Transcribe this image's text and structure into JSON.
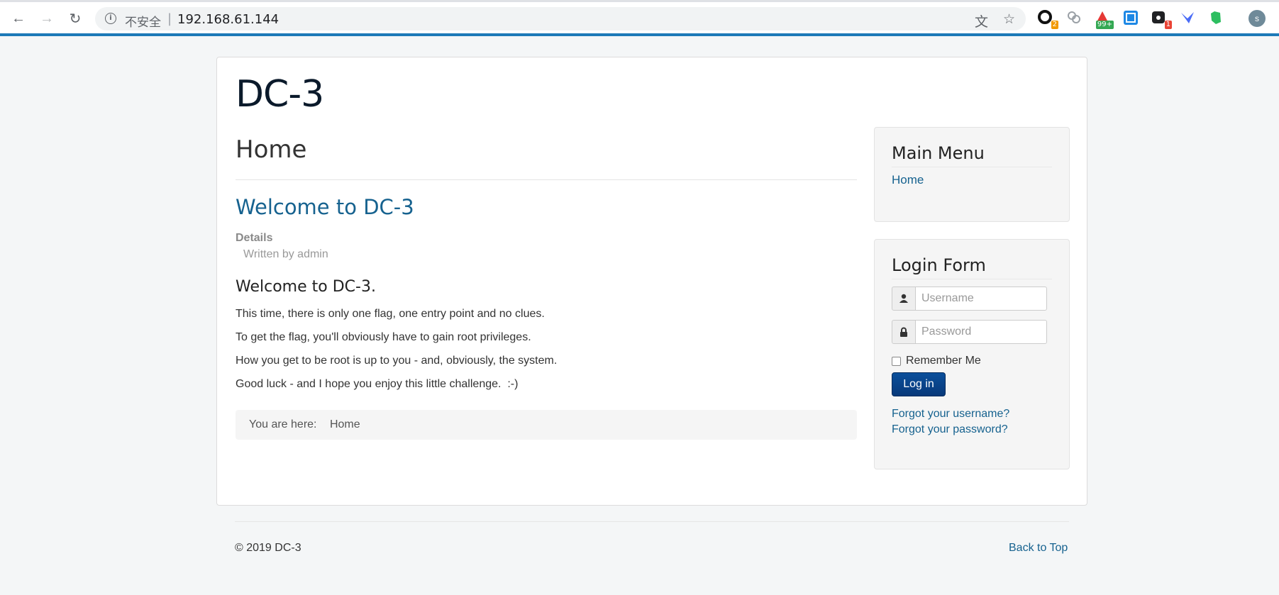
{
  "browser": {
    "security_label": "不安全",
    "separator": "|",
    "url": "192.168.61.144",
    "extensions": [
      {
        "name": "ext-circle",
        "badge": "2",
        "badge_color": "#f29900"
      },
      {
        "name": "ext-link",
        "badge": ""
      },
      {
        "name": "ext-red",
        "badge": "99+",
        "badge_color": "#34a853"
      },
      {
        "name": "ext-blue",
        "badge": ""
      },
      {
        "name": "ext-dark",
        "badge": "1",
        "badge_color": "#ea4335"
      },
      {
        "name": "ext-bird",
        "badge": ""
      },
      {
        "name": "ext-evernote",
        "badge": ""
      }
    ],
    "profile_initial": "s",
    "accent_color": "#1d7ab8"
  },
  "site": {
    "brand": "DC-3"
  },
  "main": {
    "page_title": "Home",
    "article": {
      "title": "Welcome to DC-3",
      "details_label": "Details",
      "written_by": "Written by admin",
      "heading": "Welcome to DC-3.",
      "paragraphs": [
        "This time, there is only one flag, one entry point and no clues.",
        "To get the flag, you'll obviously have to gain root privileges.",
        "How you get to be root is up to you - and, obviously, the system.",
        "Good luck - and I hope you enjoy this little challenge.  :-)"
      ]
    },
    "breadcrumb": {
      "prefix": "You are here:",
      "current": "Home"
    }
  },
  "sidebar": {
    "main_menu": {
      "title": "Main Menu",
      "items": [
        {
          "label": "Home"
        }
      ]
    },
    "login_form": {
      "title": "Login Form",
      "username_placeholder": "Username",
      "password_placeholder": "Password",
      "remember_label": "Remember Me",
      "login_label": "Log in",
      "forgot_username": "Forgot your username?",
      "forgot_password": "Forgot your password?"
    }
  },
  "footer": {
    "copyright": "© 2019 DC-3",
    "back_to_top": "Back to Top"
  }
}
